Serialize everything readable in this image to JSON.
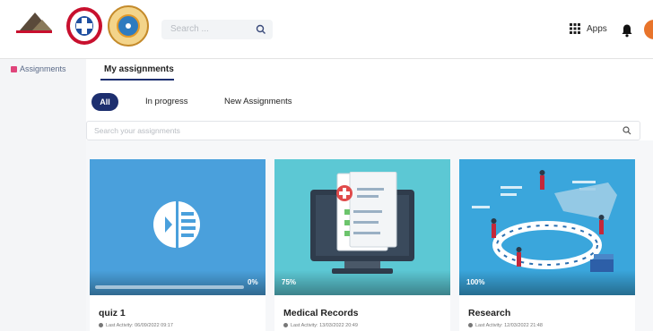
{
  "header": {
    "search_placeholder": "Search ...",
    "apps_label": "Apps"
  },
  "sidebar": {
    "items": [
      {
        "label": "Assignments",
        "icon": "assignments-icon"
      }
    ]
  },
  "page": {
    "title": "My assignments"
  },
  "filters": {
    "all": "All",
    "in_progress": "In progress",
    "new": "New Assignments"
  },
  "assignment_search": {
    "placeholder": "Search your assignments"
  },
  "cards": [
    {
      "name": "quiz 1",
      "progress_label": "0%",
      "progress": 0,
      "last_activity": "Last Activity: 06/09/2022 09:17",
      "thumb_color": "#4aa0dc"
    },
    {
      "name": "Medical Records",
      "progress_label": "75%",
      "progress": 75,
      "last_activity": "Last Activity: 13/03/2022 20:49",
      "thumb_color": "#5cc8d4"
    },
    {
      "name": "Research",
      "progress_label": "100%",
      "progress": 100,
      "last_activity": "Last Activity: 12/03/2022 21:48",
      "thumb_color": "#3aa6dc"
    }
  ],
  "colors": {
    "accent": "#1d2f6f",
    "sidebar_marker": "#e0457b"
  }
}
